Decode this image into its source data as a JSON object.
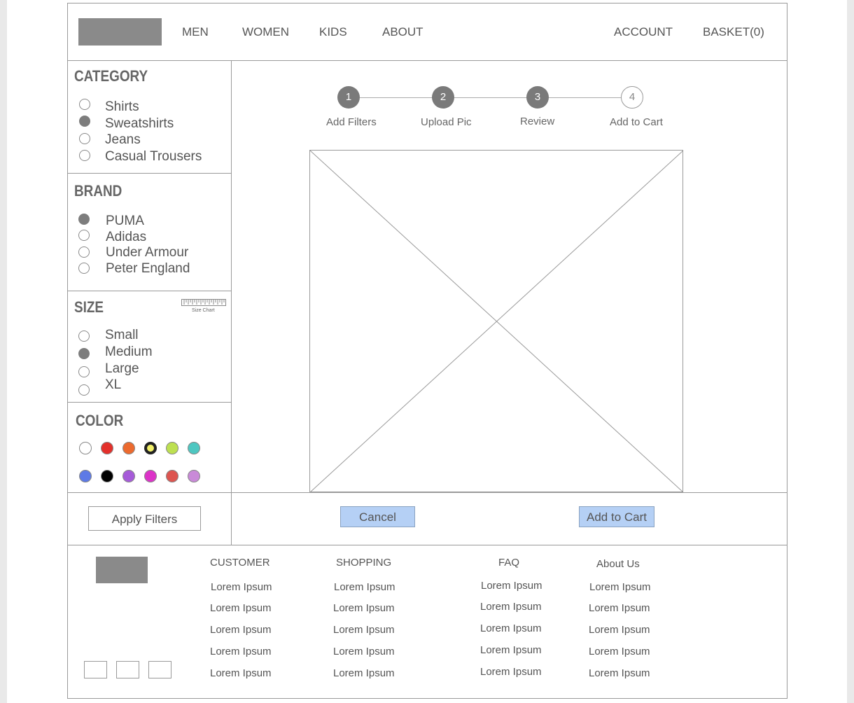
{
  "nav": {
    "items": [
      "MEN",
      "WOMEN",
      "KIDS",
      "ABOUT"
    ],
    "account": "ACCOUNT",
    "basket": "BASKET(0)"
  },
  "filters": {
    "category": {
      "title": "CATEGORY",
      "options": [
        "Shirts",
        "Sweatshirts",
        "Jeans",
        "Casual Trousers"
      ],
      "selected": "Sweatshirts"
    },
    "brand": {
      "title": "BRAND",
      "options": [
        "PUMA",
        "Adidas",
        "Under Armour",
        "Peter England"
      ],
      "selected": "PUMA"
    },
    "size": {
      "title": "SIZE",
      "size_chart_label": "Size Chart",
      "options": [
        "Small",
        "Medium",
        "Large",
        "XL"
      ],
      "selected": "Medium"
    },
    "color": {
      "title": "COLOR",
      "swatches": [
        "#ffffff",
        "#e3302b",
        "#ec6a2e",
        "#f2f06a",
        "#bde051",
        "#4ec7c1",
        "#5d7ae6",
        "#000000",
        "#a65bd9",
        "#dc33c8",
        "#dd5550",
        "#c98ad8"
      ],
      "selected": "#f2f06a"
    },
    "apply_label": "Apply Filters"
  },
  "steps": [
    {
      "number": "1",
      "label": "Add Filters",
      "state": "done"
    },
    {
      "number": "2",
      "label": "Upload Pic",
      "state": "done"
    },
    {
      "number": "3",
      "label": "Review",
      "state": "done"
    },
    {
      "number": "4",
      "label": "Add to Cart",
      "state": "pending"
    }
  ],
  "actions": {
    "cancel": "Cancel",
    "add_to_cart": "Add to Cart"
  },
  "footer": {
    "columns": [
      {
        "heading": "CUSTOMER",
        "links": [
          "Lorem Ipsum",
          "Lorem Ipsum",
          "Lorem Ipsum",
          "Lorem Ipsum",
          "Lorem Ipsum"
        ]
      },
      {
        "heading": "SHOPPING",
        "links": [
          "Lorem Ipsum",
          "Lorem Ipsum",
          "Lorem Ipsum",
          "Lorem Ipsum",
          "Lorem Ipsum"
        ]
      },
      {
        "heading": "FAQ",
        "links": [
          "Lorem Ipsum",
          "Lorem Ipsum",
          "Lorem Ipsum",
          "Lorem Ipsum",
          "Lorem Ipsum"
        ]
      },
      {
        "heading": "About Us",
        "links": [
          "Lorem Ipsum",
          "Lorem Ipsum",
          "Lorem Ipsum",
          "Lorem Ipsum",
          "Lorem Ipsum"
        ]
      }
    ]
  },
  "colors": {
    "placeholder_gray": "#8a8a8a",
    "border_gray": "#9a9a9a",
    "step_fill": "#7a7a7a",
    "button_blue": "#b5d0f5"
  }
}
